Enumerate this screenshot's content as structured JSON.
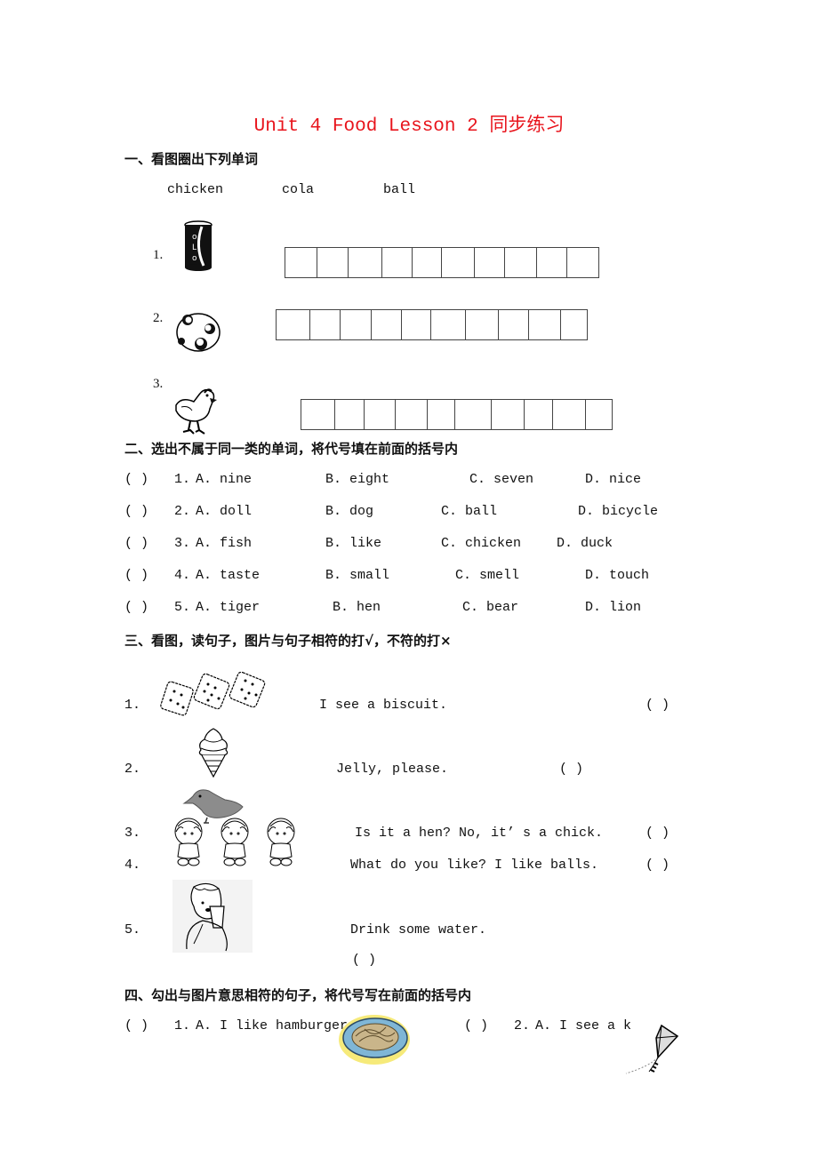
{
  "title": "Unit 4 Food Lesson 2 同步练习",
  "colors": {
    "title": "#e8141c",
    "text": "#111111"
  },
  "section1": {
    "heading": "一、看图圈出下列单词",
    "words": [
      "chicken",
      "cola",
      "ball"
    ],
    "items": [
      {
        "num": "1.",
        "picture": "cola-can",
        "boxes": 10
      },
      {
        "num": "2.",
        "picture": "ball",
        "boxes": 10
      },
      {
        "num": "3.",
        "picture": "chicken",
        "boxes": 10
      }
    ]
  },
  "section2": {
    "heading": "二、选出不属于同一类的单词，将代号填在前面的括号内",
    "items": [
      {
        "bracket": "(    )",
        "num": "1.",
        "a": "A.  nine",
        "b": "B.  eight",
        "c": "C.  seven",
        "d": "D.  nice"
      },
      {
        "bracket": "(    )",
        "num": "2.",
        "a": "A.  doll",
        "b": "B.  dog",
        "c": "C.  ball",
        "d": "D.  bicycle"
      },
      {
        "bracket": "(    )",
        "num": "3.",
        "a": "A.  fish",
        "b": "B.  like",
        "c": "C.  chicken",
        "d": "D.  duck"
      },
      {
        "bracket": "(    )",
        "num": "4.",
        "a": "A.  taste",
        "b": "B.  small",
        "c": "C.  smell",
        "d": "D.  touch"
      },
      {
        "bracket": "(    )",
        "num": "5.",
        "a": "A.  tiger",
        "b": "B.  hen",
        "c": "C.  bear",
        "d": "D.  lion"
      }
    ]
  },
  "section3": {
    "heading": "三、看图，读句子，图片与句子相符的打√，不符的打×",
    "items": [
      {
        "num": "1.",
        "picture": "biscuits",
        "sentence": "I see a biscuit.",
        "bracket": "(    )"
      },
      {
        "num": "2.",
        "picture": "ice-cream",
        "sentence": "Jelly, please.",
        "bracket": "(    )"
      },
      {
        "num": "3.",
        "picture": "chick",
        "sentence": "Is it a hen? No, it’ s a chick.",
        "bracket": "(    )"
      },
      {
        "num": "4.",
        "picture": "dolls",
        "sentence": "What do you like?  I like balls.",
        "bracket": "(    )"
      },
      {
        "num": "5.",
        "picture": "boy-drinking",
        "sentence": "Drink some water.",
        "bracket": "(    )"
      }
    ]
  },
  "section4": {
    "heading": "四、勾出与图片意思相符的句子，将代号写在前面的括号内",
    "items": [
      {
        "bracket": "(    )",
        "num": "1.",
        "a": "A.  I like hamburgers",
        "picture": "noodles-plate"
      },
      {
        "bracket": "(    )",
        "num": "2.",
        "a": "A.  I see a k",
        "picture": "kite"
      }
    ]
  }
}
